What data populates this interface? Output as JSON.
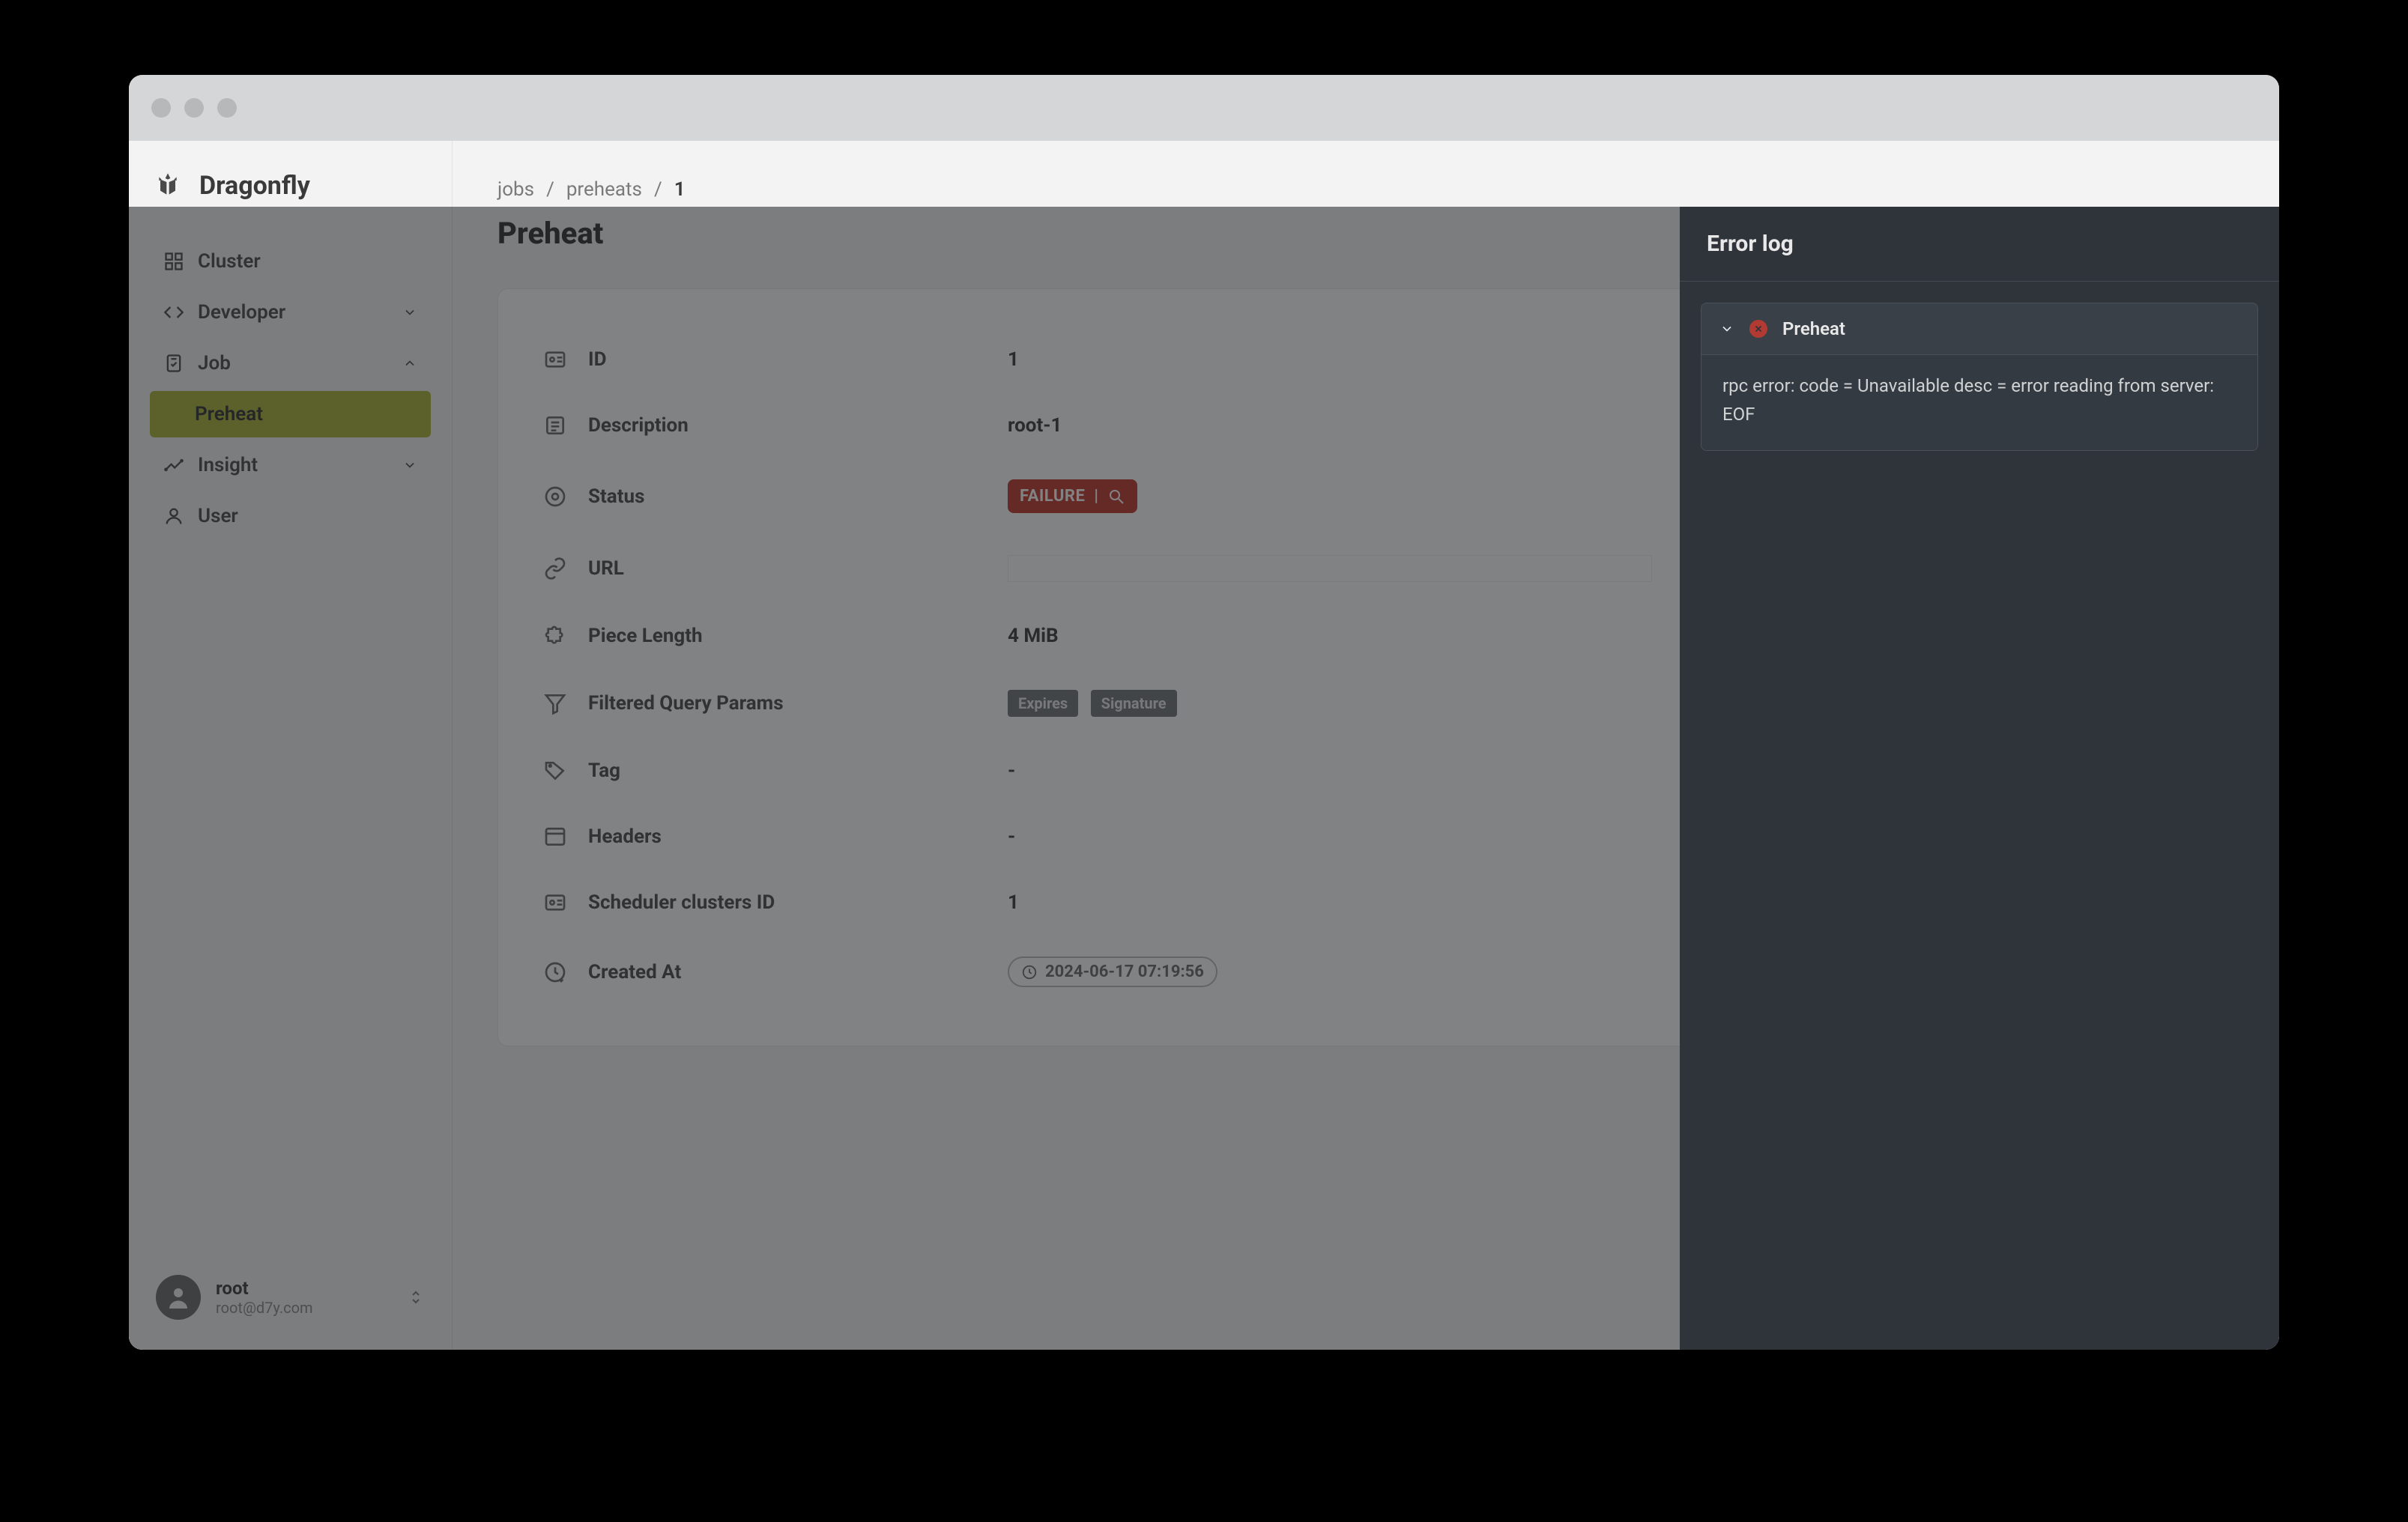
{
  "brand": "Dragonfly",
  "sidebar": {
    "items": [
      {
        "label": "Cluster"
      },
      {
        "label": "Developer"
      },
      {
        "label": "Job"
      },
      {
        "label": "Preheat"
      },
      {
        "label": "Insight"
      },
      {
        "label": "User"
      }
    ]
  },
  "user": {
    "name": "root",
    "email": "root@d7y.com"
  },
  "breadcrumb": {
    "a": "jobs",
    "b": "preheats",
    "c": "1"
  },
  "page": {
    "title": "Preheat"
  },
  "detail": {
    "id_label": "ID",
    "id_value": "1",
    "desc_label": "Description",
    "desc_value": "root-1",
    "status_label": "Status",
    "status_value": "FAILURE",
    "url_label": "URL",
    "piece_label": "Piece Length",
    "piece_value": "4 MiB",
    "filter_label": "Filtered Query Params",
    "filter_chips": [
      "Expires",
      "Signature"
    ],
    "tag_label": "Tag",
    "tag_value": "-",
    "headers_label": "Headers",
    "headers_value": "-",
    "sched_label": "Scheduler clusters ID",
    "sched_value": "1",
    "created_label": "Created At",
    "created_value": "2024-06-17 07:19:56"
  },
  "panel": {
    "title": "Error log",
    "item_title": "Preheat",
    "item_body": "rpc error: code = Unavailable desc = error reading from server: EOF"
  }
}
